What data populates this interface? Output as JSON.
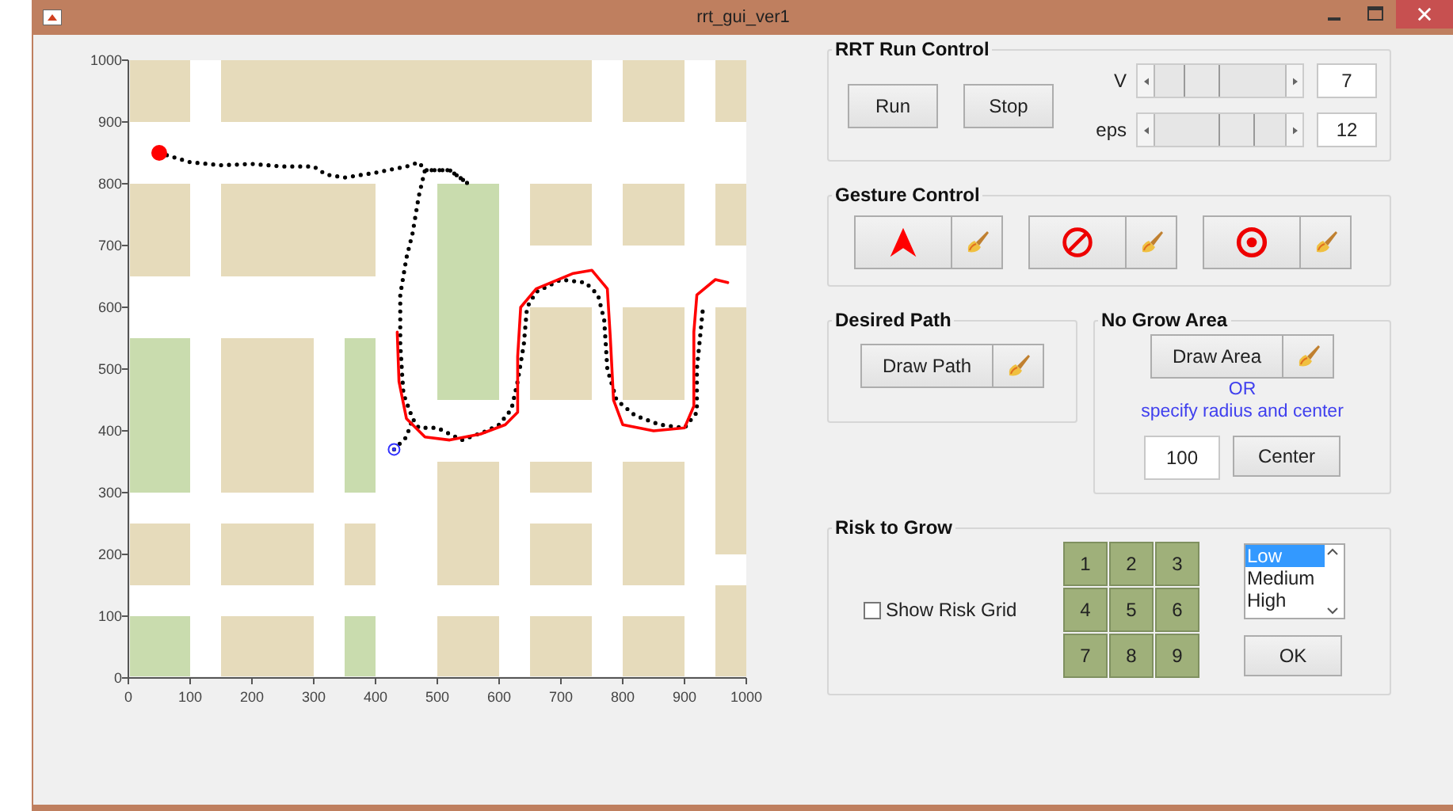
{
  "window": {
    "title": "rrt_gui_ver1"
  },
  "map": {
    "chart_data": {
      "type": "line",
      "xlim": [
        0,
        1000
      ],
      "ylim": [
        0,
        1000
      ],
      "xticks": [
        0,
        100,
        200,
        300,
        400,
        500,
        600,
        700,
        800,
        900,
        1000
      ],
      "yticks": [
        0,
        100,
        200,
        300,
        400,
        500,
        600,
        700,
        800,
        900,
        1000
      ],
      "series": [
        {
          "color": "#000000",
          "line_style": "dotted",
          "x": [
            50,
            100,
            150,
            200,
            250,
            300,
            320,
            350,
            400,
            450,
            470,
            480,
            520,
            550,
            520,
            480,
            470,
            460,
            450,
            440,
            440,
            445,
            460,
            470,
            500,
            540,
            580,
            600,
            620,
            630,
            640,
            645,
            660,
            700,
            740,
            760,
            770,
            775,
            790,
            820,
            860,
            900,
            920,
            920,
            930
          ],
          "values": [
            850,
            835,
            830,
            832,
            828,
            828,
            815,
            810,
            818,
            828,
            835,
            822,
            822,
            800,
            822,
            822,
            780,
            720,
            680,
            620,
            540,
            460,
            420,
            405,
            405,
            385,
            400,
            410,
            435,
            480,
            540,
            600,
            625,
            645,
            640,
            620,
            580,
            500,
            450,
            425,
            410,
            405,
            430,
            500,
            600
          ]
        },
        {
          "color": "#000000",
          "line_style": "dotted",
          "x": [
            430,
            450,
            460
          ],
          "values": [
            370,
            390,
            420
          ]
        },
        {
          "color": "#ff0000",
          "line_style": "solid",
          "x": [
            435,
            438,
            450,
            480,
            520,
            570,
            610,
            630,
            630,
            635,
            660,
            720,
            750,
            775,
            780,
            785,
            800,
            850,
            900,
            915,
            915,
            920,
            950,
            970
          ],
          "values": [
            560,
            480,
            420,
            390,
            385,
            395,
            410,
            430,
            520,
            600,
            630,
            655,
            660,
            630,
            550,
            450,
            410,
            400,
            405,
            440,
            560,
            620,
            645,
            640
          ]
        }
      ]
    }
  },
  "rrt_run_control": {
    "title": "RRT Run Control",
    "buttons": [
      "Run",
      "Stop"
    ],
    "sliders": [
      {
        "label": "V",
        "level": 0.3,
        "value": "7"
      },
      {
        "label": "eps",
        "level": 0.68,
        "value": "12"
      }
    ]
  },
  "gesture_control": {
    "title": "Gesture Control",
    "gestures": [
      {
        "kind": "arrow"
      },
      {
        "kind": "prohibit"
      },
      {
        "kind": "target"
      }
    ]
  },
  "desired_path": {
    "title": "Desired Path",
    "button": "Draw Path"
  },
  "no_grow_area": {
    "title": "No Grow Area",
    "button": "Draw Area",
    "hint_1": "OR",
    "hint_2": "specify radius and center",
    "radius": "100",
    "center_button": "Center"
  },
  "risk_to_grow": {
    "title": "Risk to Grow",
    "show_grid": {
      "label": "Show Risk Grid",
      "checked": false
    },
    "cells": [
      "1",
      "2",
      "3",
      "4",
      "5",
      "6",
      "7",
      "8",
      "9"
    ],
    "levels": [
      {
        "label": "Low",
        "selected": true
      },
      {
        "label": "Medium",
        "selected": false
      },
      {
        "label": "High",
        "selected": false
      }
    ],
    "ok": "OK"
  }
}
